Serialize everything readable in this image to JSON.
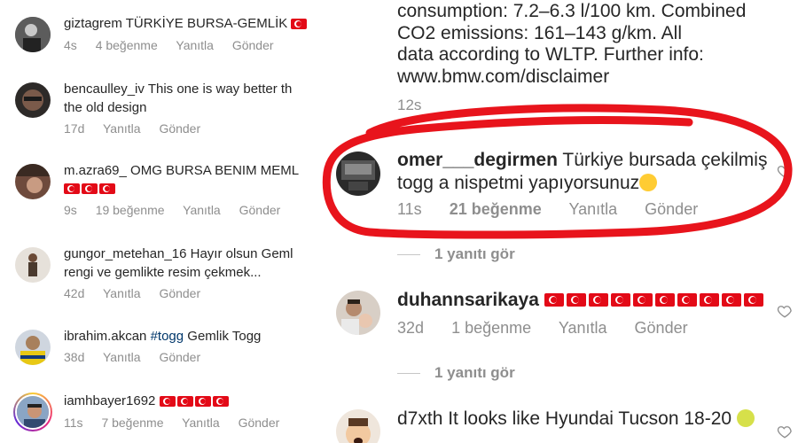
{
  "left": {
    "comments": [
      {
        "user": "giztagrem",
        "text": "TÜRKİYE BURSA-GEMLİK",
        "flags": 1,
        "time": "4s",
        "likes": "4 beğenme",
        "reply": "Yanıtla",
        "send": "Gönder"
      },
      {
        "user": "bencaulley_iv",
        "text": "This one is way better th",
        "text2": "the old design",
        "time": "17d",
        "reply": "Yanıtla",
        "send": "Gönder"
      },
      {
        "user": "m.azra69_",
        "text": "OMG BURSA BENIM MEML",
        "flags": 3,
        "time": "9s",
        "likes": "19 beğenme",
        "reply": "Yanıtla",
        "send": "Gönder"
      },
      {
        "user": "gungor_metehan_16",
        "text": "Hayır olsun Geml",
        "text2": "rengi ve gemlikte resim çekmek...",
        "time": "42d",
        "reply": "Yanıtla",
        "send": "Gönder"
      },
      {
        "user": "ibrahim.akcan",
        "tag": "#togg",
        "text": "Gemlik Togg",
        "time": "38d",
        "reply": "Yanıtla",
        "send": "Gönder"
      },
      {
        "user": "iamhbayer1692",
        "flags": 4,
        "time": "11s",
        "likes": "7 beğenme",
        "reply": "Yanıtla",
        "send": "Gönder"
      }
    ]
  },
  "right": {
    "post": {
      "line1": "consumption: 7.2–6.3 l/100 km. Combined",
      "line2": "CO2 emissions: 161–143 g/km. All",
      "line3": "data according to WLTP. Further info:",
      "line4": "www.bmw.com/disclaimer",
      "time": "12s"
    },
    "comments": [
      {
        "user": "omer___degirmen",
        "text": "Türkiye bursada çekilmiş",
        "text2": "togg a nispetmi yapıyorsunuz",
        "time": "11s",
        "likes": "21 beğenme",
        "reply": "Yanıtla",
        "send": "Gönder",
        "view_replies": "1 yanıtı gör"
      },
      {
        "user": "duhannsarikaya",
        "flags": 10,
        "time": "32d",
        "likes": "1 beğenme",
        "reply": "Yanıtla",
        "send": "Gönder",
        "view_replies": "1 yanıtı gör"
      },
      {
        "user": "d7xth",
        "text": "It looks like Hyundai Tucson 18-20"
      }
    ]
  },
  "colors": {
    "accent_circle": "#e8141c",
    "flag_red": "#e30a17",
    "muted_text": "#8e8e8e",
    "hashtag": "#00376b"
  }
}
